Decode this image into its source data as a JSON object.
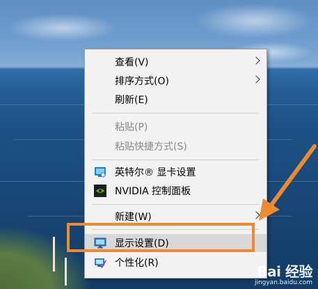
{
  "menu": {
    "items": [
      {
        "label": "查看(V)",
        "has_submenu": true,
        "enabled": true
      },
      {
        "label": "排序方式(O)",
        "has_submenu": true,
        "enabled": true
      },
      {
        "label": "刷新(E)",
        "has_submenu": false,
        "enabled": true
      },
      {
        "label": "粘贴(P)",
        "has_submenu": false,
        "enabled": false
      },
      {
        "label": "粘贴快捷方式(S)",
        "has_submenu": false,
        "enabled": false
      },
      {
        "label": "英特尔® 显卡设置",
        "has_submenu": false,
        "enabled": true,
        "icon": "intel-graphics-icon"
      },
      {
        "label": "NVIDIA 控制面板",
        "has_submenu": false,
        "enabled": true,
        "icon": "nvidia-icon"
      },
      {
        "label": "新建(W)",
        "has_submenu": true,
        "enabled": true
      },
      {
        "label": "显示设置(D)",
        "has_submenu": false,
        "enabled": true,
        "icon": "display-icon",
        "highlighted": true
      },
      {
        "label": "个性化(R)",
        "has_submenu": false,
        "enabled": true,
        "icon": "personalize-icon"
      }
    ]
  },
  "annotation": {
    "color": "#f08a30",
    "arrow_icon": "orange-arrow-icon"
  },
  "watermark": {
    "main": "Bai 经验",
    "sub": "jingyan.baidu.com"
  }
}
